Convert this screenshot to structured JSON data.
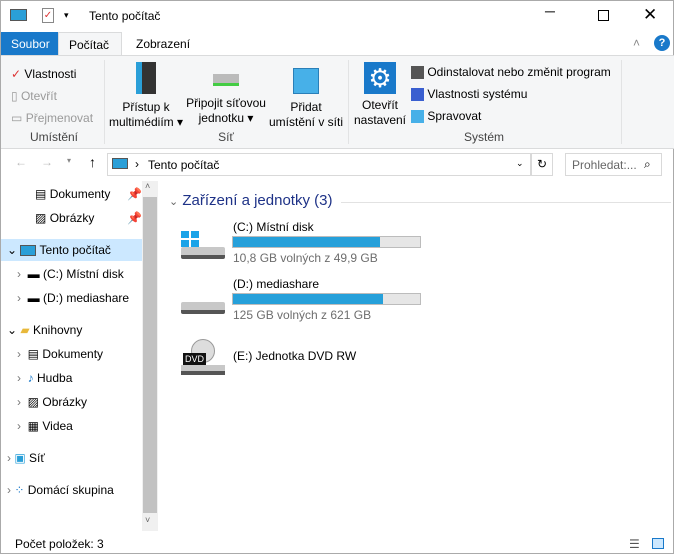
{
  "title": "Tento počítač",
  "window_controls": {
    "minimize": "minimize",
    "maximize": "maximize",
    "close": "close"
  },
  "tabs": [
    "Soubor",
    "Počítač",
    "Zobrazení"
  ],
  "ribbon": {
    "location": {
      "label": "Umístění",
      "items": [
        "Vlastnosti",
        "Otevřít",
        "Přejmenovat"
      ]
    },
    "network": {
      "label": "Síť",
      "media": [
        "Přístup k",
        "multimédiím"
      ],
      "map": [
        "Připojit síťovou",
        "jednotku"
      ],
      "add": [
        "Přidat",
        "umístění v síti"
      ]
    },
    "system": {
      "label": "Systém",
      "settings": [
        "Otevřít",
        "nastavení"
      ],
      "items": [
        "Odinstalovat nebo změnit program",
        "Vlastnosti systému",
        "Spravovat"
      ]
    }
  },
  "address": {
    "path": "Tento počítač",
    "search_placeholder": "Prohledat:..."
  },
  "sidebar": {
    "items": [
      "Dokumenty",
      "Obrázky",
      "Tento počítač",
      "(C:) Místní disk",
      "(D:) mediashare",
      "Knihovny",
      "Dokumenty",
      "Hudba",
      "Obrázky",
      "Videa",
      "Síť",
      "Domácí skupina"
    ]
  },
  "main": {
    "group": "Zařízení a jednotky (3)",
    "drives": [
      {
        "name": "(C:) Místní disk",
        "free": "10,8 GB volných z 49,9 GB",
        "used_fraction": 0.784
      },
      {
        "name": "(D:) mediashare",
        "free": "125 GB volných z 621 GB",
        "used_fraction": 0.8
      },
      {
        "name": "(E:) Jednotka DVD RW"
      }
    ]
  },
  "status": "Počet položek: 3",
  "colors": {
    "accent": "#1979ca",
    "bar": "#26a0da",
    "group": "#1e3287"
  }
}
